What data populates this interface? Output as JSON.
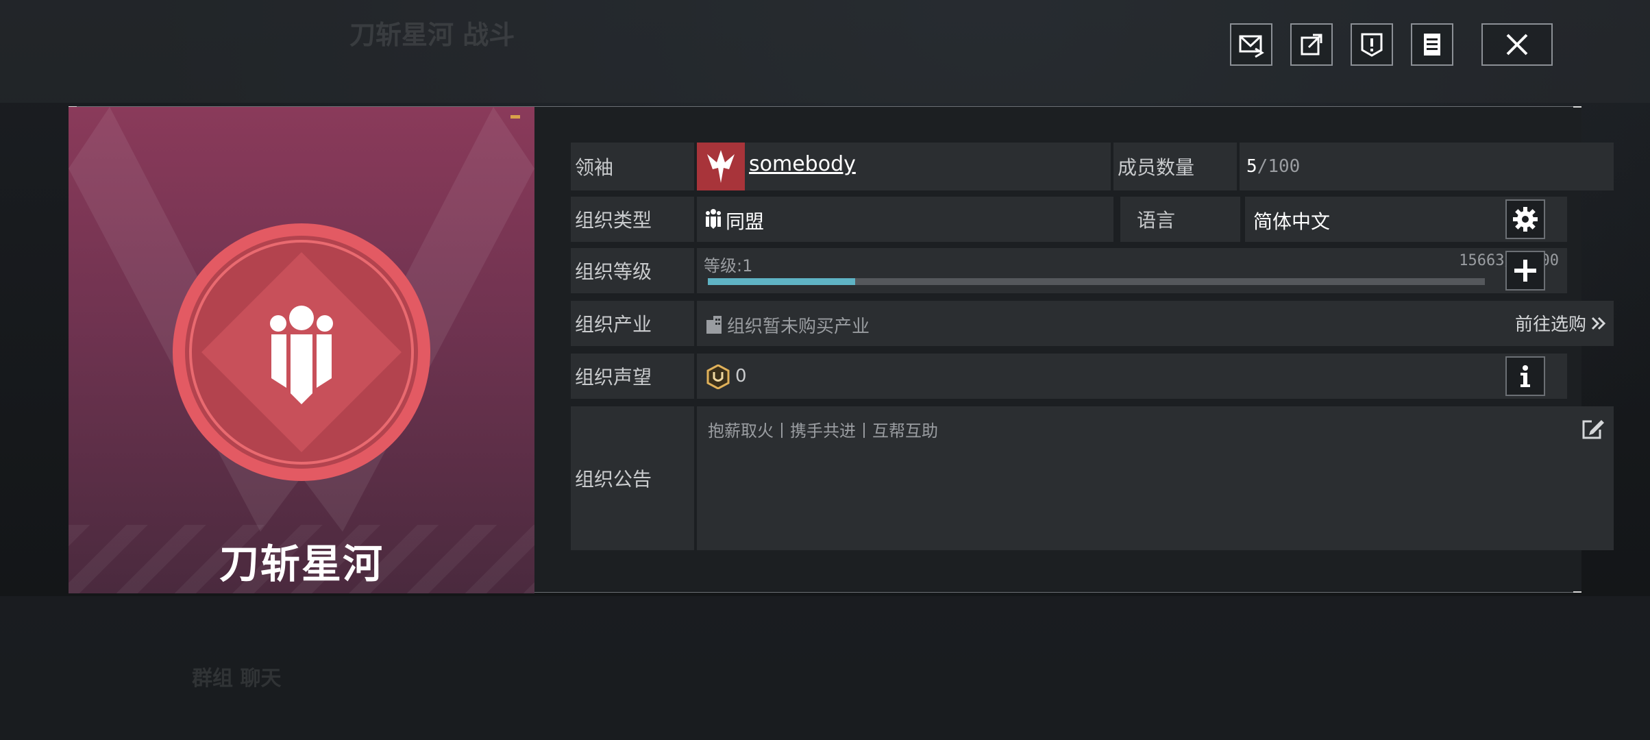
{
  "background": {
    "ghost_title": "刀斩星河 战斗",
    "ghost_bottom": "群组 聊天"
  },
  "toolbar": {
    "mail_icon": "mail-icon",
    "share_icon": "share-icon",
    "report_icon": "report-icon",
    "log_icon": "log-icon",
    "close_icon": "close-icon"
  },
  "emblem": {
    "org_name": "刀斩星河",
    "colors": {
      "ring": "#e35a63",
      "diamond": "#c8505a",
      "bg_top": "#8a3a5a"
    }
  },
  "info": {
    "leader": {
      "label": "领袖",
      "name": "somebody"
    },
    "members": {
      "label": "成员数量",
      "current": "5",
      "separator": "/",
      "max": "100"
    },
    "org_type": {
      "label": "组织类型",
      "value": "同盟"
    },
    "language": {
      "label": "语言",
      "value": "简体中文"
    },
    "level": {
      "label": "组织等级",
      "level_text": "等级:1",
      "exp_text": "15663/80000",
      "progress": 0.19
    },
    "industry": {
      "label": "组织产业",
      "value": "组织暂未购买产业",
      "action": "前往选购"
    },
    "reputation": {
      "label": "组织声望",
      "value": "0"
    },
    "announcement": {
      "label": "组织公告",
      "text": "抱薪取火丨携手共进丨互帮互助"
    }
  },
  "colors": {
    "progress_fill": "#5fb3c4",
    "progress_track": "#55585c",
    "leader_avatar_bg": "#a8343a"
  }
}
